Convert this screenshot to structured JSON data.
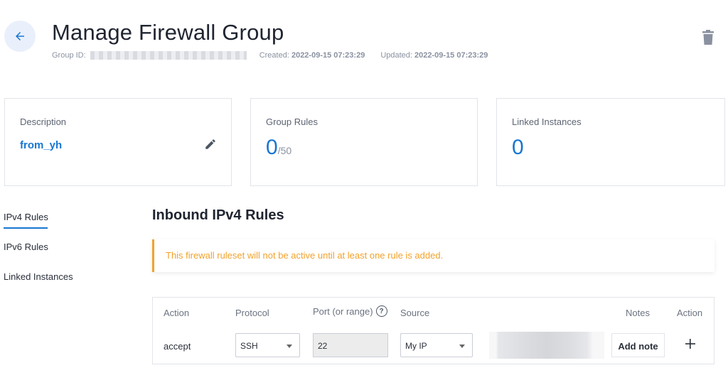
{
  "header": {
    "title": "Manage Firewall Group",
    "group_id_label": "Group ID:",
    "created_label": "Created:",
    "created_value": "2022-09-15 07:23:29",
    "updated_label": "Updated:",
    "updated_value": "2022-09-15 07:23:29"
  },
  "cards": {
    "description": {
      "label": "Description",
      "value": "from_yh"
    },
    "group_rules": {
      "label": "Group Rules",
      "value": "0",
      "max": "/50"
    },
    "linked_instances": {
      "label": "Linked Instances",
      "value": "0"
    }
  },
  "nav": {
    "items": [
      {
        "label": "IPv4 Rules",
        "active": true
      },
      {
        "label": "IPv6 Rules",
        "active": false
      },
      {
        "label": "Linked Instances",
        "active": false
      }
    ]
  },
  "section": {
    "title": "Inbound IPv4 Rules",
    "alert": "This firewall ruleset will not be active until at least one rule is added."
  },
  "table": {
    "headers": {
      "action": "Action",
      "protocol": "Protocol",
      "port": "Port (or range)",
      "source": "Source",
      "notes": "Notes",
      "row_action": "Action"
    },
    "row": {
      "action": "accept",
      "protocol": "SSH",
      "port": "22",
      "source": "My IP",
      "add_note": "Add note"
    }
  },
  "icons": {
    "back": "arrow-left-icon",
    "delete": "trash-icon",
    "edit": "pencil-icon",
    "help": "question-circle-icon",
    "add": "plus-icon"
  },
  "colors": {
    "accent": "#1976d2",
    "warning": "#f2a22b"
  }
}
